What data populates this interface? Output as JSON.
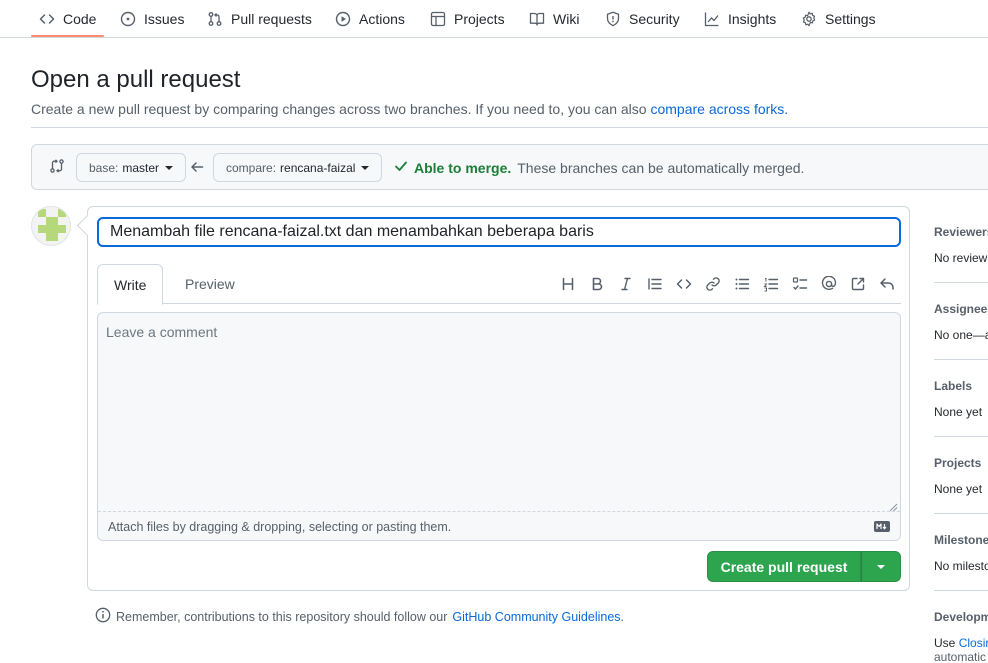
{
  "nav": {
    "items": [
      {
        "label": "Code",
        "icon": "code-icon"
      },
      {
        "label": "Issues",
        "icon": "issue-opened-icon"
      },
      {
        "label": "Pull requests",
        "icon": "git-pull-request-icon"
      },
      {
        "label": "Actions",
        "icon": "play-icon"
      },
      {
        "label": "Projects",
        "icon": "table-icon"
      },
      {
        "label": "Wiki",
        "icon": "book-icon"
      },
      {
        "label": "Security",
        "icon": "shield-icon"
      },
      {
        "label": "Insights",
        "icon": "graph-icon"
      },
      {
        "label": "Settings",
        "icon": "gear-icon"
      }
    ],
    "active": "Code"
  },
  "header": {
    "title": "Open a pull request",
    "subtitle": "Create a new pull request by comparing changes across two branches. If you need to, you can also",
    "subtitle_link": "compare across forks."
  },
  "compare": {
    "base_prefix": "base:",
    "base_branch": "master",
    "compare_prefix": "compare:",
    "compare_branch": "rencana-faizal",
    "merge_ok": "Able to merge.",
    "merge_text": "These branches can be automatically merged."
  },
  "form": {
    "title_value": "Menambah file rencana-faizal.txt dan menambahkan beberapa baris",
    "tabs": [
      "Write",
      "Preview"
    ],
    "active_tab": "Write",
    "toolbar": [
      "heading-icon",
      "bold-icon",
      "italic-icon",
      "quote-icon",
      "code-icon",
      "link-icon",
      "unordered-list-icon",
      "ordered-list-icon",
      "tasklist-icon",
      "mention-icon",
      "cross-reference-icon",
      "reply-icon"
    ],
    "comment_placeholder": "Leave a comment",
    "attach_text": "Attach files by dragging & dropping, selecting or pasting them.",
    "create_button": "Create pull request"
  },
  "reminder": {
    "text": "Remember, contributions to this repository should follow our",
    "link": "GitHub Community Guidelines",
    "period": "."
  },
  "sidebar": {
    "sections": [
      {
        "head": "Reviewers",
        "value": "No review"
      },
      {
        "head": "Assignees",
        "value": "No one—a"
      },
      {
        "head": "Labels",
        "value": "None yet"
      },
      {
        "head": "Projects",
        "value": "None yet"
      },
      {
        "head": "Milestone",
        "value": "No milesto"
      },
      {
        "head": "Developm",
        "value_prefix": "Use",
        "value_link": "Closin",
        "value2": "automatic"
      }
    ]
  },
  "colors": {
    "accent": "#0969da",
    "success": "#2da44e",
    "merge_ok": "#1a7f37",
    "nav_underline": "#fd8c73"
  }
}
